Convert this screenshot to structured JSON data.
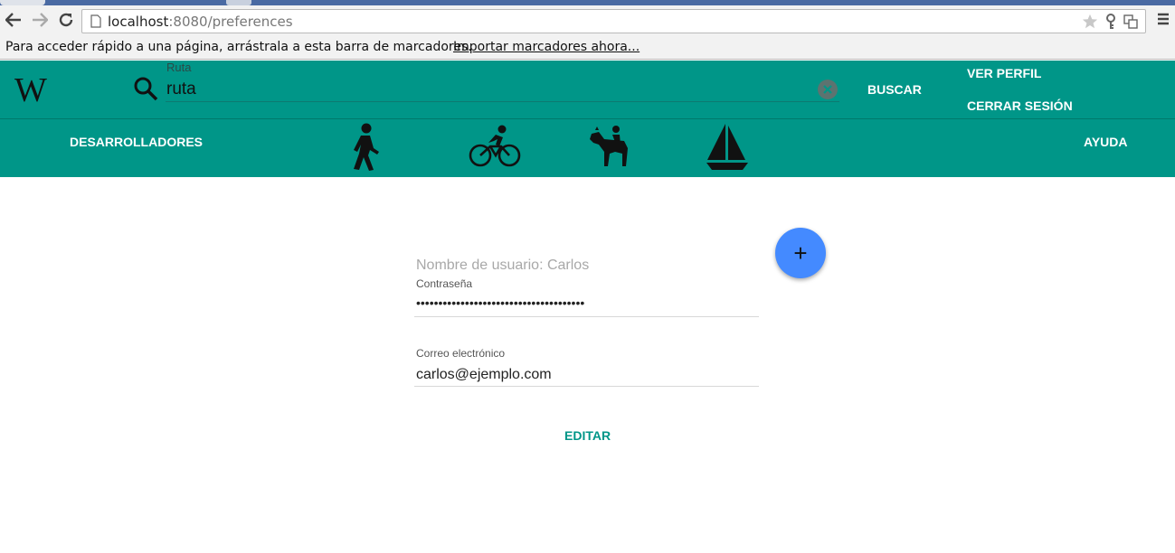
{
  "browser": {
    "url_host": "localhost",
    "url_rest": ":8080/preferences",
    "bookmarks_message": "Para acceder rápido a una página, arrástrala a esta barra de marcadores.",
    "bookmarks_link": "Importar marcadores ahora..."
  },
  "header": {
    "logo": "W",
    "search_label": "Ruta",
    "search_value": "ruta",
    "search_button": "BUSCAR",
    "profile_link": "VER PERFIL",
    "logout_link": "CERRAR SESIÓN"
  },
  "nav": {
    "developers": "DESARROLLADORES",
    "help": "AYUDA",
    "activities": [
      "walking-icon",
      "cycling-icon",
      "horse-riding-icon",
      "sailing-icon"
    ]
  },
  "form": {
    "username_label": "Nombre de usuario: Carlos",
    "password_label": "Contraseña",
    "password_value": "••••••••••••••••••••••••••••••••••••••",
    "email_label": "Correo electrónico",
    "email_value": "carlos@ejemplo.com",
    "add_button": "+",
    "edit_button": "EDITAR"
  },
  "colors": {
    "header_bg": "#009688",
    "fab_bg": "#448aff",
    "accent_text": "#009688"
  }
}
